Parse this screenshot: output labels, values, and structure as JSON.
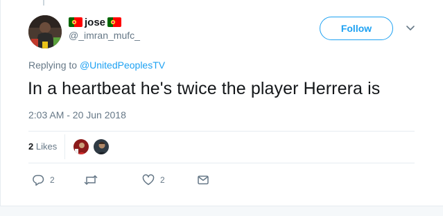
{
  "tweet": {
    "author": {
      "display_name": "jose",
      "handle": "@_imran_mufc_",
      "name_flags": [
        "portugal-flag",
        "portugal-flag"
      ]
    },
    "follow_label": "Follow",
    "replying_prefix": "Replying to",
    "replying_to": "@UnitedPeoplesTV",
    "text": "In a heartbeat he's twice the player Herrera is",
    "timestamp": "2:03 AM - 20 Jun 2018",
    "likes": {
      "count": "2",
      "label": "Likes"
    },
    "actions": {
      "reply_count": "2",
      "retweet_count": "",
      "like_count": "2"
    }
  },
  "colors": {
    "accent": "#1da1f2",
    "secondary_text": "#657786",
    "primary_text": "#14171a",
    "divider": "#e6ecf0"
  }
}
